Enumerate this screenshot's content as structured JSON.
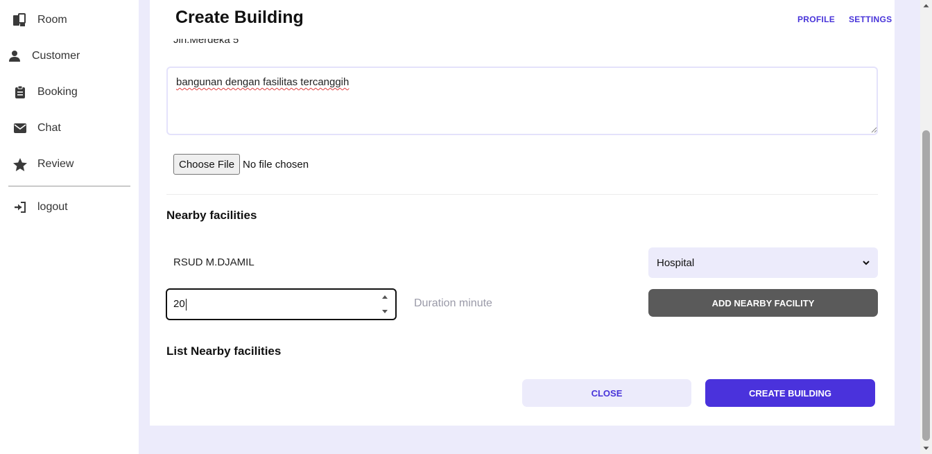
{
  "sidebar": {
    "items": [
      {
        "label": "Room",
        "icon": "room-icon"
      },
      {
        "label": "Customer",
        "icon": "user-icon"
      },
      {
        "label": "Booking",
        "icon": "clipboard-icon"
      },
      {
        "label": "Chat",
        "icon": "envelope-icon"
      },
      {
        "label": "Review",
        "icon": "star-icon"
      }
    ],
    "logout": {
      "label": "logout",
      "icon": "logout-icon"
    }
  },
  "header": {
    "title": "Create Building",
    "links": [
      "PROFILE",
      "SETTINGS"
    ]
  },
  "form": {
    "address_value": "Jln.Merdeka 5",
    "description_value": "bangunan dengan fasilitas tercanggih",
    "file_button_label": "Choose File",
    "file_status": "No file chosen",
    "nearby_title": "Nearby facilities",
    "facility_name_value": "RSUD M.DJAMIL",
    "facility_type_selected": "Hospital",
    "duration_value": "20",
    "duration_label": "Duration minute",
    "add_button_label": "ADD NEARBY FACILITY",
    "list_title": "List Nearby facilities",
    "close_button_label": "CLOSE",
    "create_button_label": "CREATE BUILDING"
  },
  "colors": {
    "accent": "#4a32dc",
    "page_background": "#ecebfb",
    "dark_button": "#5a5a5a"
  }
}
